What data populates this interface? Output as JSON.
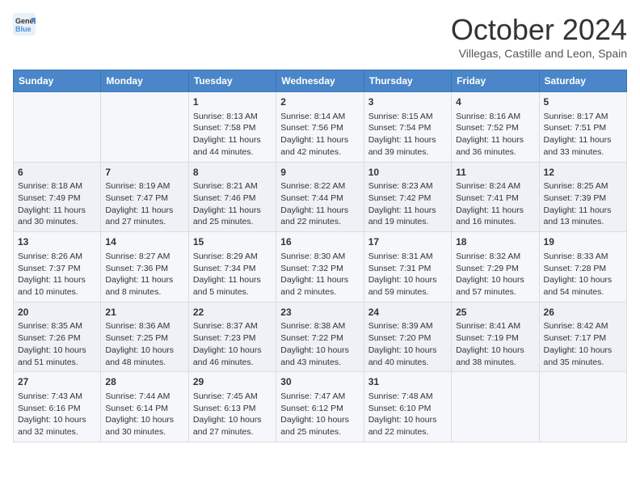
{
  "header": {
    "logo_line1": "General",
    "logo_line2": "Blue",
    "month": "October 2024",
    "location": "Villegas, Castille and Leon, Spain"
  },
  "weekdays": [
    "Sunday",
    "Monday",
    "Tuesday",
    "Wednesday",
    "Thursday",
    "Friday",
    "Saturday"
  ],
  "weeks": [
    [
      {
        "day": "",
        "content": ""
      },
      {
        "day": "",
        "content": ""
      },
      {
        "day": "1",
        "content": "Sunrise: 8:13 AM\nSunset: 7:58 PM\nDaylight: 11 hours and 44 minutes."
      },
      {
        "day": "2",
        "content": "Sunrise: 8:14 AM\nSunset: 7:56 PM\nDaylight: 11 hours and 42 minutes."
      },
      {
        "day": "3",
        "content": "Sunrise: 8:15 AM\nSunset: 7:54 PM\nDaylight: 11 hours and 39 minutes."
      },
      {
        "day": "4",
        "content": "Sunrise: 8:16 AM\nSunset: 7:52 PM\nDaylight: 11 hours and 36 minutes."
      },
      {
        "day": "5",
        "content": "Sunrise: 8:17 AM\nSunset: 7:51 PM\nDaylight: 11 hours and 33 minutes."
      }
    ],
    [
      {
        "day": "6",
        "content": "Sunrise: 8:18 AM\nSunset: 7:49 PM\nDaylight: 11 hours and 30 minutes."
      },
      {
        "day": "7",
        "content": "Sunrise: 8:19 AM\nSunset: 7:47 PM\nDaylight: 11 hours and 27 minutes."
      },
      {
        "day": "8",
        "content": "Sunrise: 8:21 AM\nSunset: 7:46 PM\nDaylight: 11 hours and 25 minutes."
      },
      {
        "day": "9",
        "content": "Sunrise: 8:22 AM\nSunset: 7:44 PM\nDaylight: 11 hours and 22 minutes."
      },
      {
        "day": "10",
        "content": "Sunrise: 8:23 AM\nSunset: 7:42 PM\nDaylight: 11 hours and 19 minutes."
      },
      {
        "day": "11",
        "content": "Sunrise: 8:24 AM\nSunset: 7:41 PM\nDaylight: 11 hours and 16 minutes."
      },
      {
        "day": "12",
        "content": "Sunrise: 8:25 AM\nSunset: 7:39 PM\nDaylight: 11 hours and 13 minutes."
      }
    ],
    [
      {
        "day": "13",
        "content": "Sunrise: 8:26 AM\nSunset: 7:37 PM\nDaylight: 11 hours and 10 minutes."
      },
      {
        "day": "14",
        "content": "Sunrise: 8:27 AM\nSunset: 7:36 PM\nDaylight: 11 hours and 8 minutes."
      },
      {
        "day": "15",
        "content": "Sunrise: 8:29 AM\nSunset: 7:34 PM\nDaylight: 11 hours and 5 minutes."
      },
      {
        "day": "16",
        "content": "Sunrise: 8:30 AM\nSunset: 7:32 PM\nDaylight: 11 hours and 2 minutes."
      },
      {
        "day": "17",
        "content": "Sunrise: 8:31 AM\nSunset: 7:31 PM\nDaylight: 10 hours and 59 minutes."
      },
      {
        "day": "18",
        "content": "Sunrise: 8:32 AM\nSunset: 7:29 PM\nDaylight: 10 hours and 57 minutes."
      },
      {
        "day": "19",
        "content": "Sunrise: 8:33 AM\nSunset: 7:28 PM\nDaylight: 10 hours and 54 minutes."
      }
    ],
    [
      {
        "day": "20",
        "content": "Sunrise: 8:35 AM\nSunset: 7:26 PM\nDaylight: 10 hours and 51 minutes."
      },
      {
        "day": "21",
        "content": "Sunrise: 8:36 AM\nSunset: 7:25 PM\nDaylight: 10 hours and 48 minutes."
      },
      {
        "day": "22",
        "content": "Sunrise: 8:37 AM\nSunset: 7:23 PM\nDaylight: 10 hours and 46 minutes."
      },
      {
        "day": "23",
        "content": "Sunrise: 8:38 AM\nSunset: 7:22 PM\nDaylight: 10 hours and 43 minutes."
      },
      {
        "day": "24",
        "content": "Sunrise: 8:39 AM\nSunset: 7:20 PM\nDaylight: 10 hours and 40 minutes."
      },
      {
        "day": "25",
        "content": "Sunrise: 8:41 AM\nSunset: 7:19 PM\nDaylight: 10 hours and 38 minutes."
      },
      {
        "day": "26",
        "content": "Sunrise: 8:42 AM\nSunset: 7:17 PM\nDaylight: 10 hours and 35 minutes."
      }
    ],
    [
      {
        "day": "27",
        "content": "Sunrise: 7:43 AM\nSunset: 6:16 PM\nDaylight: 10 hours and 32 minutes."
      },
      {
        "day": "28",
        "content": "Sunrise: 7:44 AM\nSunset: 6:14 PM\nDaylight: 10 hours and 30 minutes."
      },
      {
        "day": "29",
        "content": "Sunrise: 7:45 AM\nSunset: 6:13 PM\nDaylight: 10 hours and 27 minutes."
      },
      {
        "day": "30",
        "content": "Sunrise: 7:47 AM\nSunset: 6:12 PM\nDaylight: 10 hours and 25 minutes."
      },
      {
        "day": "31",
        "content": "Sunrise: 7:48 AM\nSunset: 6:10 PM\nDaylight: 10 hours and 22 minutes."
      },
      {
        "day": "",
        "content": ""
      },
      {
        "day": "",
        "content": ""
      }
    ]
  ]
}
